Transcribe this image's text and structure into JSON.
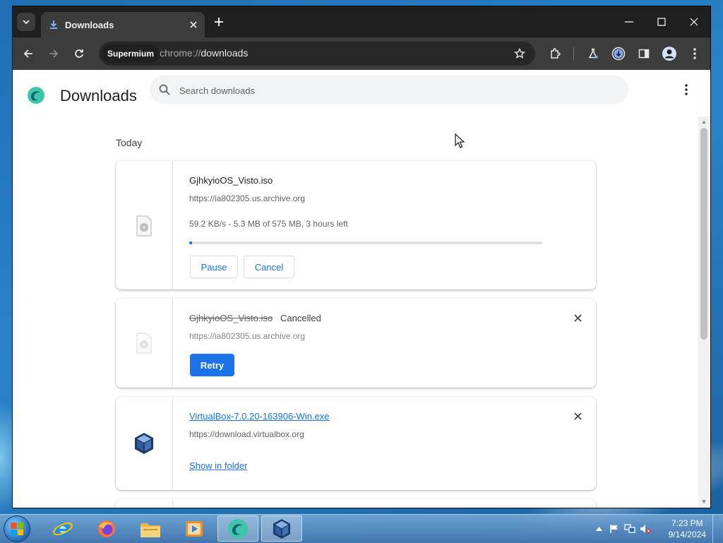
{
  "browser": {
    "tab": {
      "title": "Downloads"
    },
    "profile_chip": "Supermium",
    "url_scheme": "chrome://",
    "url_path": "downloads"
  },
  "page": {
    "title": "Downloads",
    "search_placeholder": "Search downloads",
    "section_label": "Today"
  },
  "downloads": [
    {
      "filename": "GjhkyioOS_Visto.iso",
      "source": "https://ia802305.us.archive.org",
      "progress_text": "59.2 KB/s - 5.3 MB of 575 MB, 3 hours left",
      "progress_fraction": 0.009,
      "pause_label": "Pause",
      "cancel_label": "Cancel"
    },
    {
      "filename": "GjhkyioOS_Visto.iso",
      "status": "Cancelled",
      "source": "https://ia802305.us.archive.org",
      "retry_label": "Retry"
    },
    {
      "filename": "VirtualBox-7.0.20-163906-Win.exe",
      "source": "https://download.virtualbox.org",
      "show_in_folder_label": "Show in folder"
    }
  ],
  "taskbar": {
    "clock_time": "7:23 PM",
    "clock_date": "9/14/2024"
  },
  "colors": {
    "accent": "#1a73e8",
    "tabstrip": "#1f1f1f",
    "toolbar": "#3c3c3c"
  }
}
